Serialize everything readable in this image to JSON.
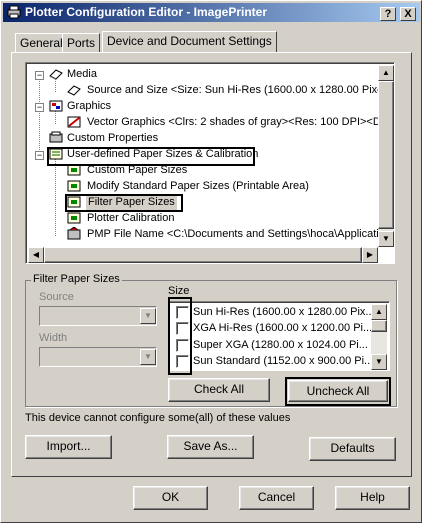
{
  "window": {
    "title": "Plotter Configuration Editor - ImagePrinter",
    "help_btn": "?",
    "close_btn": "X"
  },
  "tabs": [
    {
      "label": "General"
    },
    {
      "label": "Ports"
    },
    {
      "label": "Device and Document Settings"
    }
  ],
  "tree": {
    "items": [
      {
        "label": "Media"
      },
      {
        "label": "Source and Size <Size: Sun Hi-Res (1600.00 x 1280.00 Pixels"
      },
      {
        "label": "Graphics"
      },
      {
        "label": "Vector Graphics <Clrs: 2 shades of gray><Res: 100 DPI><Dth"
      },
      {
        "label": "Custom Properties"
      },
      {
        "label": "User-defined Paper Sizes & Calibration"
      },
      {
        "label": "Custom Paper Sizes"
      },
      {
        "label": "Modify Standard Paper Sizes (Printable Area)"
      },
      {
        "label": "Filter Paper Sizes"
      },
      {
        "label": "Plotter Calibration"
      },
      {
        "label": "PMP File Name <C:\\Documents and Settings\\hoca\\Applicatio"
      }
    ]
  },
  "filter_group": {
    "title": "Filter Paper Sizes",
    "source_label": "Source",
    "width_label": "Width",
    "size_label": "Size",
    "sizes": [
      {
        "label": "Sun Hi-Res (1600.00 x 1280.00 Pix..."
      },
      {
        "label": "XGA Hi-Res (1600.00 x 1200.00 Pi..."
      },
      {
        "label": "Super XGA (1280.00 x 1024.00 Pi..."
      },
      {
        "label": "Sun Standard (1152.00 x 900.00 Pi..."
      }
    ],
    "check_all": "Check All",
    "uncheck_all": "Uncheck All"
  },
  "status_text": "This device cannot configure some(all) of these values",
  "buttons": {
    "import": "Import...",
    "save_as": "Save As...",
    "defaults": "Defaults",
    "ok": "OK",
    "cancel": "Cancel",
    "help": "Help"
  },
  "colors": {
    "title_start": "#0a246a",
    "title_end": "#a6caf0",
    "face": "#d4d0c8"
  }
}
